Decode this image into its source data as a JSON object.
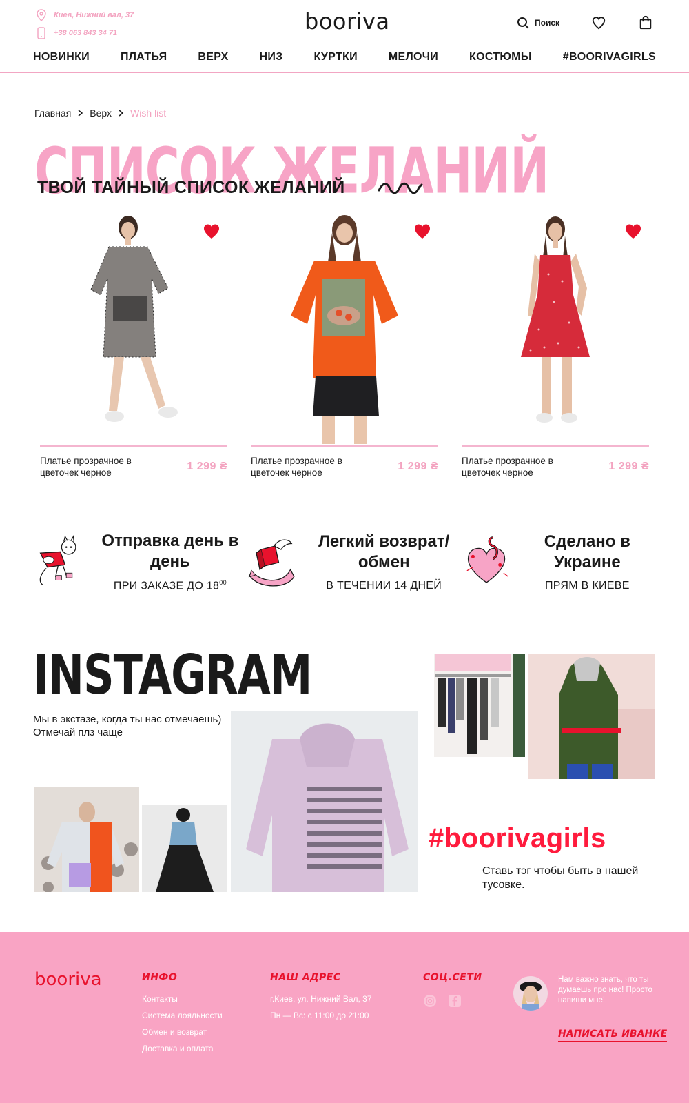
{
  "header": {
    "address": "Киев, Нижний вал, 37",
    "phone": "+38 063 843 34 71",
    "logo": "booriva",
    "search_label": "Поиск",
    "icons": [
      "location-icon",
      "phone-icon",
      "search-icon",
      "heart-icon",
      "bag-icon"
    ]
  },
  "nav": {
    "items": [
      "НОВИНКИ",
      "ПЛАТЬЯ",
      "ВЕРХ",
      "НИЗ",
      "КУРТКИ",
      "МЕЛОЧИ",
      "КОСТЮМЫ",
      "#BOORIVAGIRLS"
    ]
  },
  "breadcrumb": [
    "Главная",
    "Верх",
    "Wish list"
  ],
  "page": {
    "title": "СПИСОК ЖЕЛАНИЙ",
    "subtitle": "ТВОЙ ТАЙНЫЙ СПИСОК ЖЕЛАНИЙ"
  },
  "products": [
    {
      "name": "Платье прозрачное в цветочек черное",
      "price": "1 299 ₴"
    },
    {
      "name": "Платье прозрачное в цветочек черное",
      "price": "1 299 ₴"
    },
    {
      "name": "Платье прозрачное в цветочек черное",
      "price": "1 299 ₴"
    }
  ],
  "features": [
    {
      "title": "Отправка день в день",
      "sub": "ПРИ ЗАКАЗЕ ДО 18",
      "sup": "00"
    },
    {
      "title": "Легкий возврат/обмен",
      "sub": "В ТЕЧЕНИИ 14 ДНЕЙ"
    },
    {
      "title": "Сделано в Украине",
      "sub": "ПРЯМ В КИЕВЕ"
    }
  ],
  "instagram": {
    "title": "INSTAGRAM",
    "text": "Мы в экстазе, когда ты нас отмечаешь)  Отмечай плз чаще",
    "hashtag": "#boorivagirls",
    "hashtag_text": "Ставь тэг чтобы быть в нашей тусовке."
  },
  "footer": {
    "logo": "booriva",
    "info_heading": "ИНФО",
    "info_links": [
      "Контакты",
      "Система лояльности",
      "Обмен и возврат",
      "Доставка и оплата"
    ],
    "address_heading": "НАШ АДРЕС",
    "address": "г.Киев, ул. Нижний Вал, 37",
    "hours": "Пн — Вс: с 11:00 до 21:00",
    "social_heading": "СОЦ.СЕТИ",
    "message": "Нам важно знать, что ты думаешь про нас! Просто напиши мне!",
    "cta": "НАПИСАТЬ ИВАНКЕ"
  },
  "colors": {
    "pink": "#f9a4c4",
    "light_pink": "#f3a3c0",
    "red": "#e8122d",
    "hashtag_red": "#ff1b3d"
  }
}
